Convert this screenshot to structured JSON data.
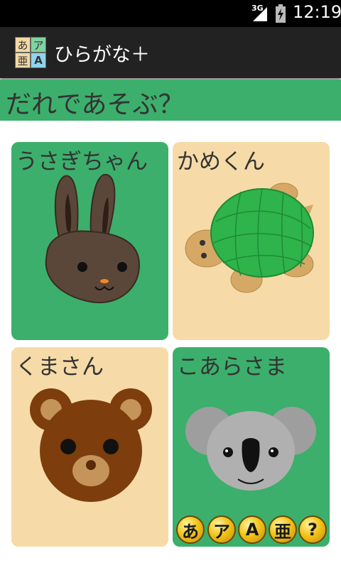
{
  "status_bar": {
    "network": "3G",
    "time": "12:19"
  },
  "action_bar": {
    "icon_chars": [
      "あ",
      "ア",
      "亜",
      "A"
    ],
    "title": "ひらがな＋"
  },
  "prompt": {
    "text": "だれであそぶ？"
  },
  "cards": [
    {
      "label": "うさぎちゃん",
      "animal": "rabbit",
      "background": "#3caf6c"
    },
    {
      "label": "かめくん",
      "animal": "turtle",
      "background": "#f6dba8"
    },
    {
      "label": "くまさん",
      "animal": "bear",
      "background": "#f6dba8"
    },
    {
      "label": "こあらさま",
      "animal": "koala",
      "background": "#3caf6c"
    }
  ],
  "mode_buttons": [
    "あ",
    "ア",
    "A",
    "亜",
    "?"
  ],
  "colors": {
    "status_bar": "#000000",
    "action_bar": "#222222",
    "accent_green": "#3caf6c",
    "card_tan": "#f6dba8",
    "button_gold": "#f2c41a"
  }
}
